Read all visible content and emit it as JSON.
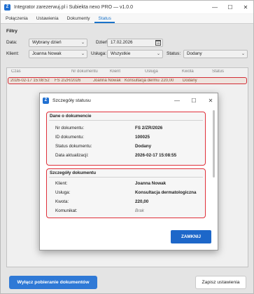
{
  "window": {
    "title": "Integrator zarezerwuj.pl i Subiekta nexo PRO — v1.0.0",
    "minimize_glyph": "—",
    "maximize_glyph": "☐",
    "close_glyph": "✕",
    "icon_letter": "Z"
  },
  "tabs": [
    {
      "label": "Połączenia",
      "active": false
    },
    {
      "label": "Ustawienia",
      "active": false
    },
    {
      "label": "Dokumenty",
      "active": false
    },
    {
      "label": "Status",
      "active": true
    }
  ],
  "filters": {
    "title": "Filtry",
    "date_label": "Data:",
    "date_value": "Wybrany dzień",
    "day_label": "Dzień:",
    "day_value": "17.02.2026",
    "calendar_glyph": "15",
    "client_label": "Klient:",
    "client_value": "Joanna Nowak",
    "service_label": "Usługa:",
    "service_value": "Wszystkie",
    "status_label": "Status:",
    "status_value": "Dodany",
    "chevron": "⌄"
  },
  "grid": {
    "columns": [
      "Czas",
      "Nr dokumentu",
      "Klient",
      "Usługa",
      "Kwota",
      "Status"
    ],
    "rows": [
      [
        "2026-02-17 15:08:52",
        "FS 2/ZR/2026",
        "Joanna Nowak",
        "Konsultacja dermu",
        "220,00",
        "Dodany"
      ]
    ]
  },
  "dialog": {
    "title": "Szczegóły statusu",
    "document_section": {
      "title": "Dane o dokumencie",
      "fields": [
        {
          "label": "Nr dokumentu:",
          "value": "FS 2/ZR/2026"
        },
        {
          "label": "ID dokumentu:",
          "value": "100025"
        },
        {
          "label": "Status dokumentu:",
          "value": "Dodany"
        },
        {
          "label": "Data aktualizacji:",
          "value": "2026-02-17 15:08:55"
        }
      ]
    },
    "details_section": {
      "title": "Szczegóły dokumentu",
      "fields": [
        {
          "label": "Klient:",
          "value": "Joanna Nowak"
        },
        {
          "label": "Usługa:",
          "value": "Konsultacja dermatologiczna"
        },
        {
          "label": "Kwota:",
          "value": "220,00"
        },
        {
          "label": "Komunikat:",
          "value": "Brak"
        }
      ]
    },
    "close_button": "ZAMKNIJ"
  },
  "footer": {
    "toggle_button": "Wyłącz pobieranie dokumentów",
    "save_button": "Zapisz ustawienia"
  },
  "colors": {
    "accent": "#1d67c9",
    "highlight_border": "#e0303a"
  }
}
